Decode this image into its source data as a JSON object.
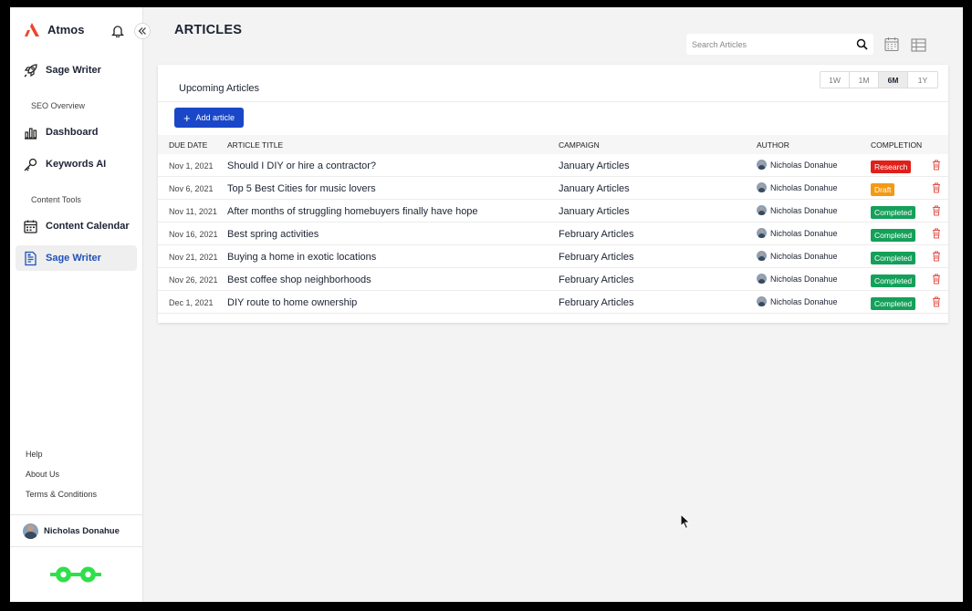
{
  "app": {
    "brand": "Atmos",
    "title": "ARTICLES"
  },
  "sidebar": {
    "top_item": "Sage Writer",
    "section1": "SEO Overview",
    "dashboard": "Dashboard",
    "keywords": "Keywords AI",
    "section2": "Content Tools",
    "calendar": "Content Calendar",
    "writer": "Sage Writer",
    "help": "Help",
    "about": "About Us",
    "terms": "Terms & Conditions",
    "user": "Nicholas Donahue"
  },
  "search": {
    "placeholder": "Search Articles"
  },
  "card": {
    "title": "Upcoming Articles",
    "add_label": "Add article",
    "ranges": [
      "1W",
      "1M",
      "6M",
      "1Y"
    ],
    "active_range": "6M"
  },
  "table": {
    "headers": {
      "due": "DUE DATE",
      "title": "ARTICLE TITLE",
      "campaign": "CAMPAIGN",
      "author": "AUTHOR",
      "completion": "COMPLETION"
    },
    "rows": [
      {
        "due": "Nov 1, 2021",
        "title": "Should I DIY or hire a contractor?",
        "campaign": "January Articles",
        "author": "Nicholas Donahue",
        "status": "Research"
      },
      {
        "due": "Nov 6, 2021",
        "title": "Top 5 Best Cities for music lovers",
        "campaign": "January Articles",
        "author": "Nicholas Donahue",
        "status": "Draft"
      },
      {
        "due": "Nov 11, 2021",
        "title": "After months of struggling homebuyers finally have hope",
        "campaign": "January Articles",
        "author": "Nicholas Donahue",
        "status": "Completed"
      },
      {
        "due": "Nov 16, 2021",
        "title": "Best spring activities",
        "campaign": "February Articles",
        "author": "Nicholas Donahue",
        "status": "Completed"
      },
      {
        "due": "Nov 21, 2021",
        "title": "Buying a home in exotic locations",
        "campaign": "February Articles",
        "author": "Nicholas Donahue",
        "status": "Completed"
      },
      {
        "due": "Nov 26, 2021",
        "title": "Best coffee shop neighborhoods",
        "campaign": "February Articles",
        "author": "Nicholas Donahue",
        "status": "Completed"
      },
      {
        "due": "Dec 1, 2021",
        "title": "DIY route to home ownership",
        "campaign": "February Articles",
        "author": "Nicholas Donahue",
        "status": "Completed"
      }
    ]
  },
  "colors": {
    "accent": "#1a47c7",
    "research": "#e0201b",
    "draft": "#f39a12",
    "completed": "#15a05a",
    "trash": "#e0554f",
    "logo_green": "#2ee04a",
    "brand_red": "#f0442c"
  },
  "icons": [
    "bell-icon",
    "chevron-double-left-icon",
    "rocket-icon",
    "dashboard-icon",
    "key-icon",
    "calendar-icon",
    "document-icon",
    "search-icon",
    "calendar-view-icon",
    "table-view-icon",
    "plus-icon",
    "trash-icon",
    "glasses-logo-icon",
    "cursor-icon"
  ]
}
